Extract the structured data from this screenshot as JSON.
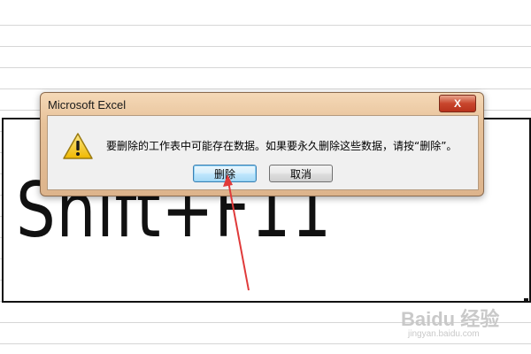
{
  "spreadsheet": {
    "cell_text": "Shift+F11"
  },
  "dialog": {
    "title": "Microsoft Excel",
    "close_label": "X",
    "message": "要删除的工作表中可能存在数据。如果要永久删除这些数据，请按“删除”。",
    "icon": "warning-icon",
    "buttons": {
      "delete_label": "删除",
      "cancel_label": "取消"
    }
  },
  "annotation": {
    "arrow_color": "#e03a3a",
    "points_to": "delete-button"
  },
  "watermark": {
    "logo": "Baidu 经验",
    "url": "jingyan.baidu.com"
  },
  "colors": {
    "title_bar": "#e7c29a",
    "close_button": "#c8452c",
    "default_button_border": "#3c7fb1",
    "warning_yellow": "#f5d142"
  }
}
